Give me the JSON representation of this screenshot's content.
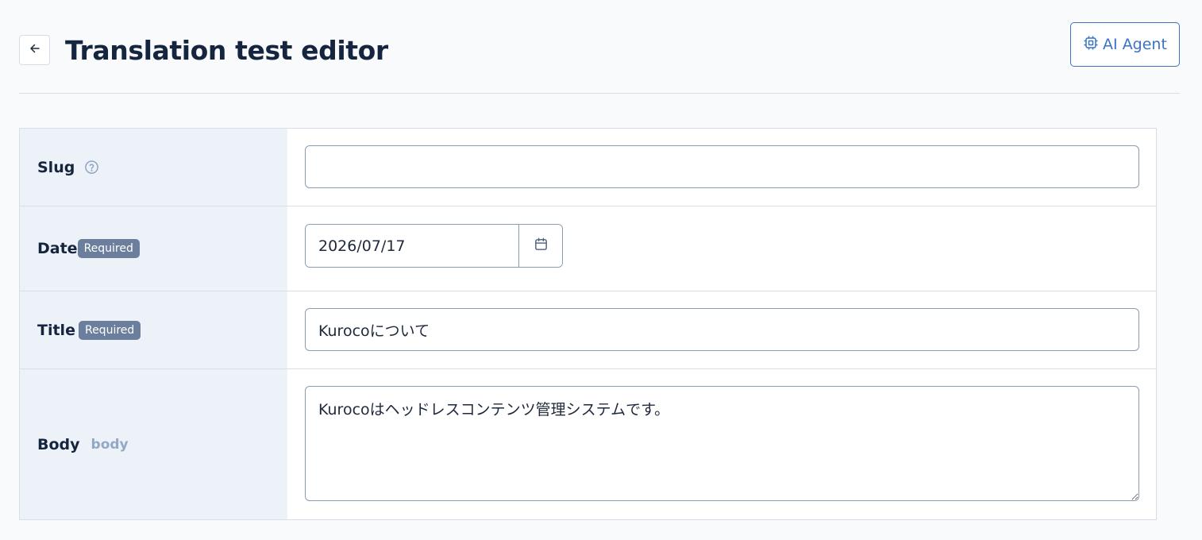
{
  "header": {
    "back_icon": "arrow-left-icon",
    "title": "Translation test editor",
    "ai_agent_label": "AI Agent",
    "ai_agent_icon": "chip-icon"
  },
  "fields": {
    "slug": {
      "label": "Slug",
      "help_icon": "question-circle-icon",
      "value": ""
    },
    "date": {
      "label": "Date",
      "badge": "Required",
      "value": "2026/07/17",
      "calendar_icon": "calendar-icon"
    },
    "title": {
      "label": "Title",
      "badge": "Required",
      "value": "Kurocoについて"
    },
    "body": {
      "label": "Body",
      "key_hint": "body",
      "value": "Kurocoはヘッドレスコンテンツ管理システムです。"
    }
  },
  "colors": {
    "accent": "#3a72c4",
    "badge_bg": "#6b7f9c",
    "label_bg": "#edf2f8",
    "title_text": "#15253f"
  }
}
